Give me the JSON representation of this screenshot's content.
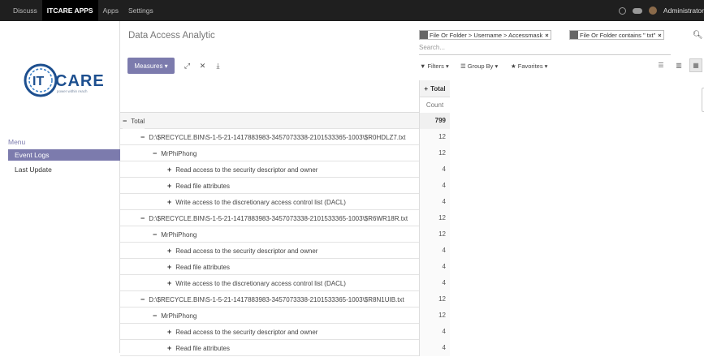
{
  "topbar": {
    "nav": [
      "Discuss",
      "ITCARE APPS",
      "Apps",
      "Settings"
    ],
    "user": "Administrator"
  },
  "sidebar": {
    "logo_text": "CARE",
    "logo_prefix": "IT",
    "logo_tagline": "power within reach",
    "menu_title": "Menu",
    "items": [
      {
        "label": "Event Logs",
        "active": true
      },
      {
        "label": "Last Update",
        "active": false
      }
    ]
  },
  "main": {
    "title": "Data Access Analytic",
    "measures_label": "Measures ▾",
    "search": {
      "facets": [
        {
          "text": "File Or Folder > Username > Accessmask"
        },
        {
          "text": "File Or Folder contains \" txt\""
        }
      ],
      "placeholder": "Search..."
    },
    "filters_label": "Filters ▾",
    "groupby_label": "Group By ▾",
    "favorites_label": "Favorites ▾"
  },
  "pivot": {
    "header_total": "Total",
    "header_measure": "Count",
    "rows": [
      {
        "sym": "−",
        "label": "Total",
        "value": "799",
        "level": 0,
        "total": true
      },
      {
        "sym": "−",
        "label": "D:\\$RECYCLE.BIN\\S-1-5-21-1417883983-3457073338-2101533365-1003\\$R0HDLZ7.txt",
        "value": "12",
        "level": 1
      },
      {
        "sym": "−",
        "label": "MrPhiPhong",
        "value": "12",
        "level": 2
      },
      {
        "sym": "+",
        "label": "Read access to the security descriptor and owner",
        "value": "4",
        "level": 3
      },
      {
        "sym": "+",
        "label": "Read file attributes",
        "value": "4",
        "level": 3
      },
      {
        "sym": "+",
        "label": "Write access to the discretionary access control list (DACL)",
        "value": "4",
        "level": 3
      },
      {
        "sym": "−",
        "label": "D:\\$RECYCLE.BIN\\S-1-5-21-1417883983-3457073338-2101533365-1003\\$R6WR18R.txt",
        "value": "12",
        "level": 1
      },
      {
        "sym": "−",
        "label": "MrPhiPhong",
        "value": "12",
        "level": 2
      },
      {
        "sym": "+",
        "label": "Read access to the security descriptor and owner",
        "value": "4",
        "level": 3
      },
      {
        "sym": "+",
        "label": "Read file attributes",
        "value": "4",
        "level": 3
      },
      {
        "sym": "+",
        "label": "Write access to the discretionary access control list (DACL)",
        "value": "4",
        "level": 3
      },
      {
        "sym": "−",
        "label": "D:\\$RECYCLE.BIN\\S-1-5-21-1417883983-3457073338-2101533365-1003\\$R8N1UIB.txt",
        "value": "12",
        "level": 1
      },
      {
        "sym": "−",
        "label": "MrPhiPhong",
        "value": "12",
        "level": 2
      },
      {
        "sym": "+",
        "label": "Read access to the security descriptor and owner",
        "value": "4",
        "level": 3
      },
      {
        "sym": "+",
        "label": "Read file attributes",
        "value": "4",
        "level": 3
      }
    ]
  }
}
